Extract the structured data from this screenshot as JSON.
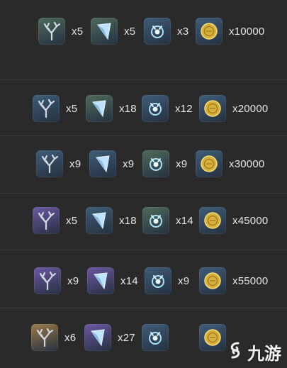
{
  "colors": {
    "background": "#2a2a2a",
    "tile_green": "#4f6b5c",
    "tile_blue": "#3f5d79",
    "tile_purple": "#6d58a4",
    "tile_orange": "#9b7a47",
    "gold": "#d7b13d"
  },
  "rows": [
    {
      "items": [
        {
          "icon": "coral-branch-icon",
          "tile": "tile_green",
          "qty": "x5"
        },
        {
          "icon": "crystal-shard-icon",
          "tile": "tile_green",
          "qty": "x5"
        },
        {
          "icon": "spirit-orb-icon",
          "tile": "tile_blue",
          "qty": "x3"
        },
        {
          "icon": "mora-coin-icon",
          "tile": "tile_blue",
          "qty": "x10000"
        }
      ]
    },
    {
      "items": [
        {
          "icon": "coral-branch-icon",
          "tile": "tile_blue",
          "qty": "x5"
        },
        {
          "icon": "crystal-shard-icon",
          "tile": "tile_green",
          "qty": "x18"
        },
        {
          "icon": "spirit-orb-icon",
          "tile": "tile_blue",
          "qty": "x12"
        },
        {
          "icon": "mora-coin-icon",
          "tile": "tile_blue",
          "qty": "x20000"
        }
      ]
    },
    {
      "items": [
        {
          "icon": "coral-branch-icon",
          "tile": "tile_blue",
          "qty": "x9"
        },
        {
          "icon": "crystal-shard-icon",
          "tile": "tile_blue",
          "qty": "x9"
        },
        {
          "icon": "spirit-orb-icon",
          "tile": "tile_green",
          "qty": "x9"
        },
        {
          "icon": "mora-coin-icon",
          "tile": "tile_blue",
          "qty": "x30000"
        }
      ]
    },
    {
      "items": [
        {
          "icon": "coral-branch-icon",
          "tile": "tile_purple",
          "qty": "x5"
        },
        {
          "icon": "crystal-shard-icon",
          "tile": "tile_blue",
          "qty": "x18"
        },
        {
          "icon": "spirit-orb-icon",
          "tile": "tile_green",
          "qty": "x14"
        },
        {
          "icon": "mora-coin-icon",
          "tile": "tile_blue",
          "qty": "x45000"
        }
      ]
    },
    {
      "items": [
        {
          "icon": "coral-branch-icon",
          "tile": "tile_purple",
          "qty": "x9"
        },
        {
          "icon": "crystal-shard-icon",
          "tile": "tile_purple",
          "qty": "x14"
        },
        {
          "icon": "spirit-orb-icon",
          "tile": "tile_blue",
          "qty": "x9"
        },
        {
          "icon": "mora-coin-icon",
          "tile": "tile_blue",
          "qty": "x55000"
        }
      ]
    },
    {
      "items": [
        {
          "icon": "coral-branch-icon",
          "tile": "tile_orange",
          "qty": "x6"
        },
        {
          "icon": "crystal-shard-icon",
          "tile": "tile_purple",
          "qty": "x27"
        },
        {
          "icon": "spirit-orb-icon",
          "tile": "tile_blue",
          "qty": ""
        },
        {
          "icon": "mora-coin-icon",
          "tile": "tile_blue",
          "qty": ""
        }
      ]
    }
  ],
  "watermark": {
    "icon": "jiuyou-logo-icon",
    "text": "九游"
  }
}
